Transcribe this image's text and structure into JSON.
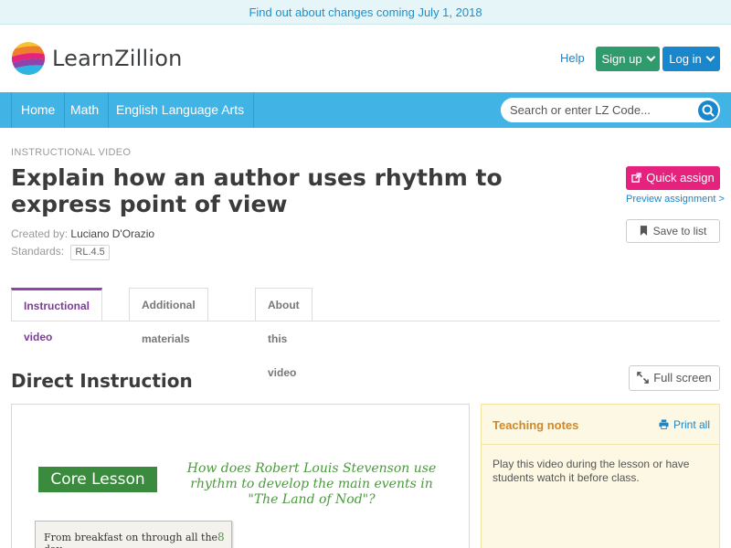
{
  "banner": {
    "text": "Find out about changes coming July 1, 2018"
  },
  "header": {
    "logo_text": "LearnZillion",
    "help": "Help",
    "signup": "Sign up",
    "login": "Log in"
  },
  "nav": {
    "items": [
      "Home",
      "Math",
      "English Language Arts"
    ],
    "search_placeholder": "Search or enter LZ Code..."
  },
  "lesson": {
    "kicker": "INSTRUCTIONAL VIDEO",
    "title": "Explain how an author uses rhythm to express point of view",
    "created_by_label": "Created by:",
    "created_by": "Luciano D'Orazio",
    "standards_label": "Standards:",
    "standard": "RL.4.5"
  },
  "actions": {
    "quick_assign": "Quick assign",
    "preview": "Preview assignment >",
    "save": "Save to list"
  },
  "tabs": [
    "Instructional video",
    "Additional materials",
    "About this video"
  ],
  "section": {
    "title": "Direct Instruction",
    "fullscreen": "Full screen"
  },
  "video": {
    "core_lesson": "Core Lesson",
    "question": "How does Robert Louis Stevenson use rhythm to develop the main events in \"The Land of Nod\"?",
    "page_text": "From breakfast on through all the day",
    "page_num": "8"
  },
  "notes": {
    "title": "Teaching notes",
    "print": "Print all",
    "text": "Play this video during the lesson or have students watch it before class."
  },
  "colors": {
    "nav_blue": "#42b3e5",
    "signup_green": "#2f9a6c",
    "login_blue": "#1a87cc",
    "quick_assign_pink": "#e5237e",
    "tab_active_purple": "#8e44ad",
    "notes_orange": "#d0892a"
  }
}
